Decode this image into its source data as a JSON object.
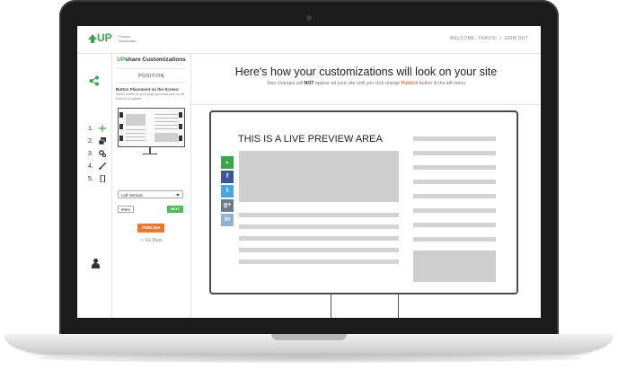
{
  "header": {
    "logo_text": "UP",
    "logo_sub": "Partner Dashboard",
    "welcome": "WELCOME, TRAVIS!",
    "divider": "|",
    "signout": "SIGN OUT"
  },
  "sidebar": {
    "steps": [
      {
        "num": "1.",
        "icon": "move-icon"
      },
      {
        "num": "2.",
        "icon": "layers-icon"
      },
      {
        "num": "3.",
        "icon": "gears-icon"
      },
      {
        "num": "4.",
        "icon": "brush-icon"
      },
      {
        "num": "5.",
        "icon": "mobile-icon"
      }
    ]
  },
  "panel": {
    "title_up": "UP",
    "title_rest": "share Customizations",
    "section": "POSITION",
    "placement_label": "Button Placement on the Screen:",
    "placement_desc": "Select where on your page you want your social buttons to appear",
    "select_value": "Left Vertical",
    "prev": "PREV",
    "next": "NEXT",
    "publish": "PUBLISH",
    "go_back": "Go Back"
  },
  "main": {
    "title": "Here's how your customizations will look on your site",
    "sub_pre": "Your changes will ",
    "sub_not": "NOT",
    "sub_mid": " appear on your site until you click orange ",
    "sub_publish": "Publish",
    "sub_post": " button in the left menu",
    "preview_label": "THIS IS A LIVE PREVIEW AREA"
  },
  "share_buttons": [
    {
      "name": "upshare",
      "glyph": "▲",
      "color": "#3aa64a"
    },
    {
      "name": "facebook",
      "glyph": "f",
      "color": "#3b5998"
    },
    {
      "name": "twitter",
      "glyph": "t",
      "color": "#4aa7de"
    },
    {
      "name": "googleplus",
      "glyph": "g+",
      "color": "#6d7a8c"
    },
    {
      "name": "linkedin",
      "glyph": "in",
      "color": "#8fb3d0"
    }
  ],
  "colors": {
    "accent": "#3aa64a",
    "publish": "#f0782a"
  }
}
